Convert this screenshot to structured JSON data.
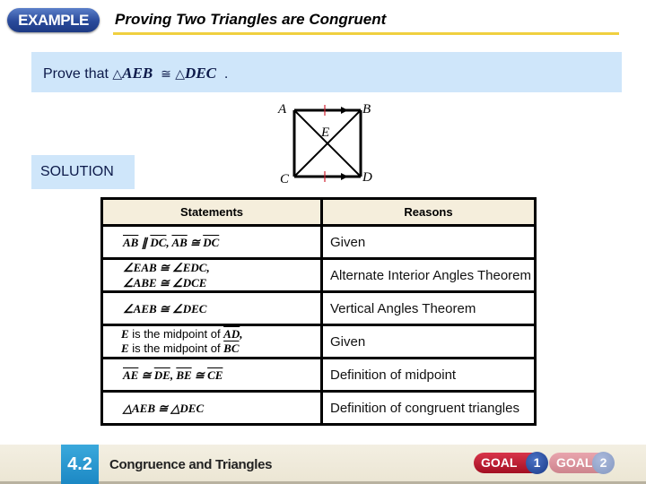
{
  "header": {
    "badge": "EXAMPLE",
    "title": "Proving Two Triangles are Congruent"
  },
  "prove": {
    "prefix": "Prove that ",
    "triangle1_symbol": "△",
    "triangle1": "AEB",
    "congruent_symbol": "≅",
    "triangle2_symbol": "△",
    "triangle2": "DEC",
    "suffix": "."
  },
  "solution_label": "SOLUTION",
  "diagram": {
    "labels": {
      "A": "A",
      "B": "B",
      "C": "C",
      "D": "D",
      "E": "E"
    },
    "colors": {
      "lines": "#000000",
      "tick_marks": "#d02030"
    }
  },
  "table": {
    "headers": {
      "statements": "Statements",
      "reasons": "Reasons"
    },
    "rows": [
      {
        "statement_parts": [
          "AB",
          " ∥ ",
          "DC",
          ", ",
          "AB",
          " ≅ ",
          "DC"
        ],
        "reason": "Given"
      },
      {
        "statement_lines": [
          "∠EAB ≅ ∠EDC,",
          "∠ABE ≅ ∠DCE"
        ],
        "reason": "Alternate Interior Angles Theorem"
      },
      {
        "statement": "∠AEB ≅ ∠DEC",
        "reason": "Vertical Angles Theorem"
      },
      {
        "statement_lines": [
          {
            "point": "E",
            "text": " is the midpoint of ",
            "segment": "AD",
            "end": ","
          },
          {
            "point": "E",
            "text": " is the midpoint of ",
            "segment": "BC",
            "end": ""
          }
        ],
        "reason": "Given"
      },
      {
        "statement_parts": [
          "AE",
          " ≅ ",
          "DE",
          ", ",
          "BE",
          " ≅ ",
          "CE"
        ],
        "reason": "Definition of midpoint"
      },
      {
        "statement": "△AEB ≅ △DEC",
        "reason": "Definition of congruent triangles"
      }
    ]
  },
  "footer": {
    "lesson_number": "4.2",
    "lesson_title": "Congruence and Triangles",
    "goals": [
      {
        "label": "GOAL",
        "number": "1",
        "active": true
      },
      {
        "label": "GOAL",
        "number": "2",
        "active": false
      }
    ],
    "colors": {
      "lesson_badge": "#1c88c4",
      "goal_active": "#b81a2e",
      "goal_inactive": "#cc7f8a"
    }
  }
}
